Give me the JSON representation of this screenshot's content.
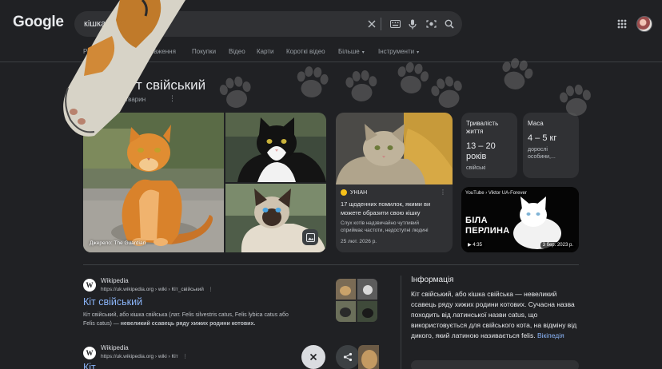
{
  "header": {
    "logo": "Google",
    "query": "кішка",
    "clear_icon": "close-icon",
    "keyboard_icon": "keyboard-icon",
    "voice_icon": "microphone-icon",
    "lens_icon": "camera-search-icon",
    "search_icon": "search-icon",
    "apps_icon": "apps-grid-icon"
  },
  "tabs": [
    "Ро",
    "ображення",
    "Покупки",
    "Відео",
    "Карти",
    "Короткі відео",
    "Більше",
    "Інструменти"
  ],
  "knowledge": {
    "title": "т свійський",
    "subtitle": "ство тварин",
    "image_source": "Джерело: The Guardian"
  },
  "news": {
    "source": "УНІАН",
    "title": "17 щоденних помилок, якими ви можете образити свою кішку",
    "snippet_1": "Слух котів надзвичайно чутливий",
    "snippet_2": "сприймає частоти, недоступні людині",
    "date": "25 лют. 2026 р."
  },
  "facts": [
    {
      "label": "Тривалість життя",
      "value": "13 – 20 років",
      "note": "свійські"
    },
    {
      "label": "Маса",
      "value": "4 – 5 кг",
      "note": "дорослі особини,..."
    }
  ],
  "video": {
    "channel": "YouTube › Viktor UA-Forever",
    "overlay_text_1": "БІЛА",
    "overlay_text_2": "ПЕРЛИНА",
    "duration": "4:35",
    "date": "3 бер. 2023 р."
  },
  "results": [
    {
      "site": "Wikipedia",
      "url": "https://uk.wikipedia.org › wiki › Кіт_свійський",
      "title": "Кіт свійський",
      "snippet_1": "Кіт свійський, або кішка свійська (лат. Felis silvestris catus, Felis lybica catus або",
      "snippet_2a": "Felis catus) — ",
      "snippet_2b": "невеликий ссавець ряду хижих родини котових."
    },
    {
      "site": "Wikipedia",
      "url": "https://uk.wikipedia.org › wiki › Кіт",
      "title": "Кіт"
    }
  ],
  "info": {
    "heading": "Інформація",
    "body": "Кіт свійський, або кішка свійська — невеликий ссавець ряду хижих родини котових. Сучасна назва походить від латинської назви catus, що використовується для свійського кота, на відміну від дикого, який латиною називається felis.",
    "link": "Вікіпедія"
  },
  "float_buttons": {
    "close_icon": "close-icon",
    "share_icon": "share-icon"
  }
}
